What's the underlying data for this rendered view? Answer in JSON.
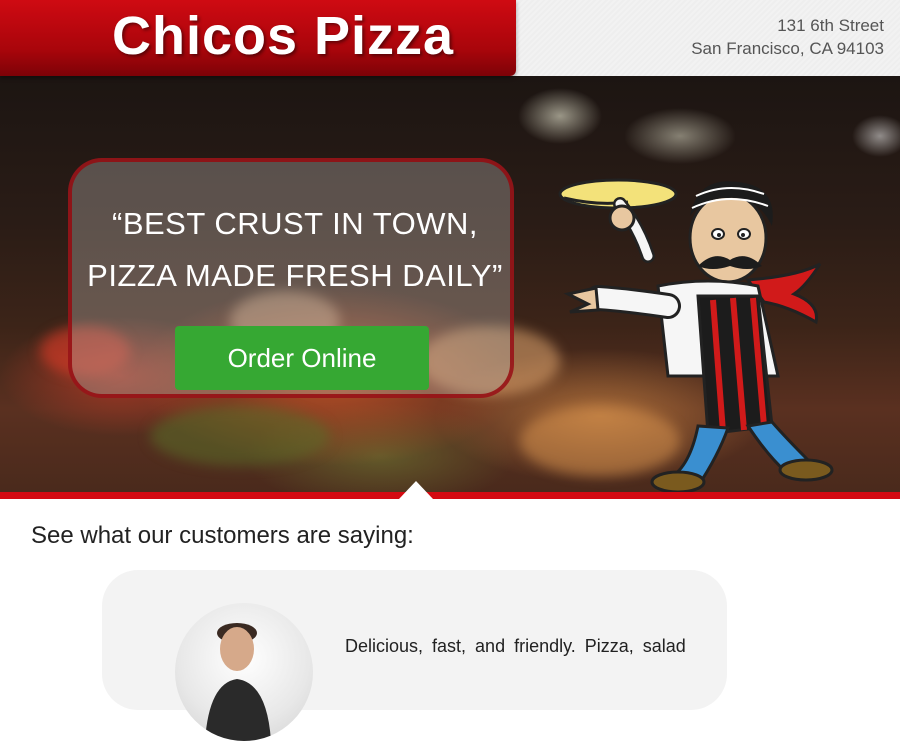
{
  "header": {
    "logo_text": "Chicos Pizza",
    "address_line1": "131 6th Street",
    "address_line2": "San Francisco, CA 94103"
  },
  "hero": {
    "quote_line1": "“BEST CRUST IN TOWN,",
    "quote_line2": "PIZZA MADE FRESH DAILY”",
    "order_button_label": "Order Online"
  },
  "testimonials": {
    "section_title": "See what our customers are saying:",
    "items": [
      {
        "text": "Delicious, fast, and friendly. Pizza, salad"
      }
    ]
  },
  "colors": {
    "brand_red": "#d40a12",
    "button_green": "#36a833"
  },
  "icons": [
    "chef-mascot-illustration",
    "customer-avatar"
  ]
}
